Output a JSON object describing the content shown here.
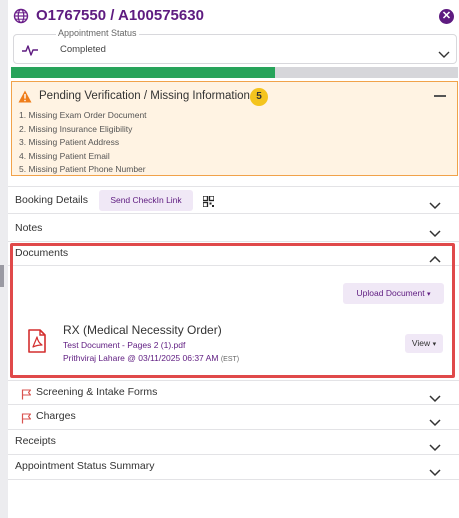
{
  "header": {
    "title": "O1767550 / A100575630",
    "globe_icon": "globe-icon",
    "close_icon": "close-icon",
    "close_glyph": "✕",
    "accent_color": "#5e1b80"
  },
  "appointment_status": {
    "label": "Appointment Status",
    "value": "Completed",
    "icon": "pulse-icon"
  },
  "progress": {
    "fraction": 0.59,
    "fill_color": "#27a35a"
  },
  "pending": {
    "title": "Pending Verification / Missing Information",
    "count": "5",
    "items": [
      "1. Missing Exam Order Document",
      "2. Missing Insurance Eligibility",
      "3. Missing Patient Address",
      "4. Missing Patient Email",
      "5. Missing Patient Phone Number"
    ],
    "border_color": "#f1a24a",
    "background_color": "#fff3e3"
  },
  "sections": {
    "booking_details": "Booking Details",
    "send_checkin_link": "Send CheckIn Link",
    "notes": "Notes",
    "documents": "Documents",
    "screening": "Screening & Intake Forms",
    "charges": "Charges",
    "receipts": "Receipts",
    "appointment_status_summary": "Appointment Status Summary"
  },
  "documents": {
    "upload_label": "Upload Document",
    "item": {
      "title": "RX (Medical Necessity Order)",
      "file_name": "Test Document - Pages 2 (1).pdf",
      "uploaded_by": "Prithviraj Lahare @ 03/11/2025 06:37 AM",
      "timezone": "(EST)",
      "view_label": "View",
      "icon": "pdf-icon"
    },
    "highlight_color": "#e0494a"
  }
}
